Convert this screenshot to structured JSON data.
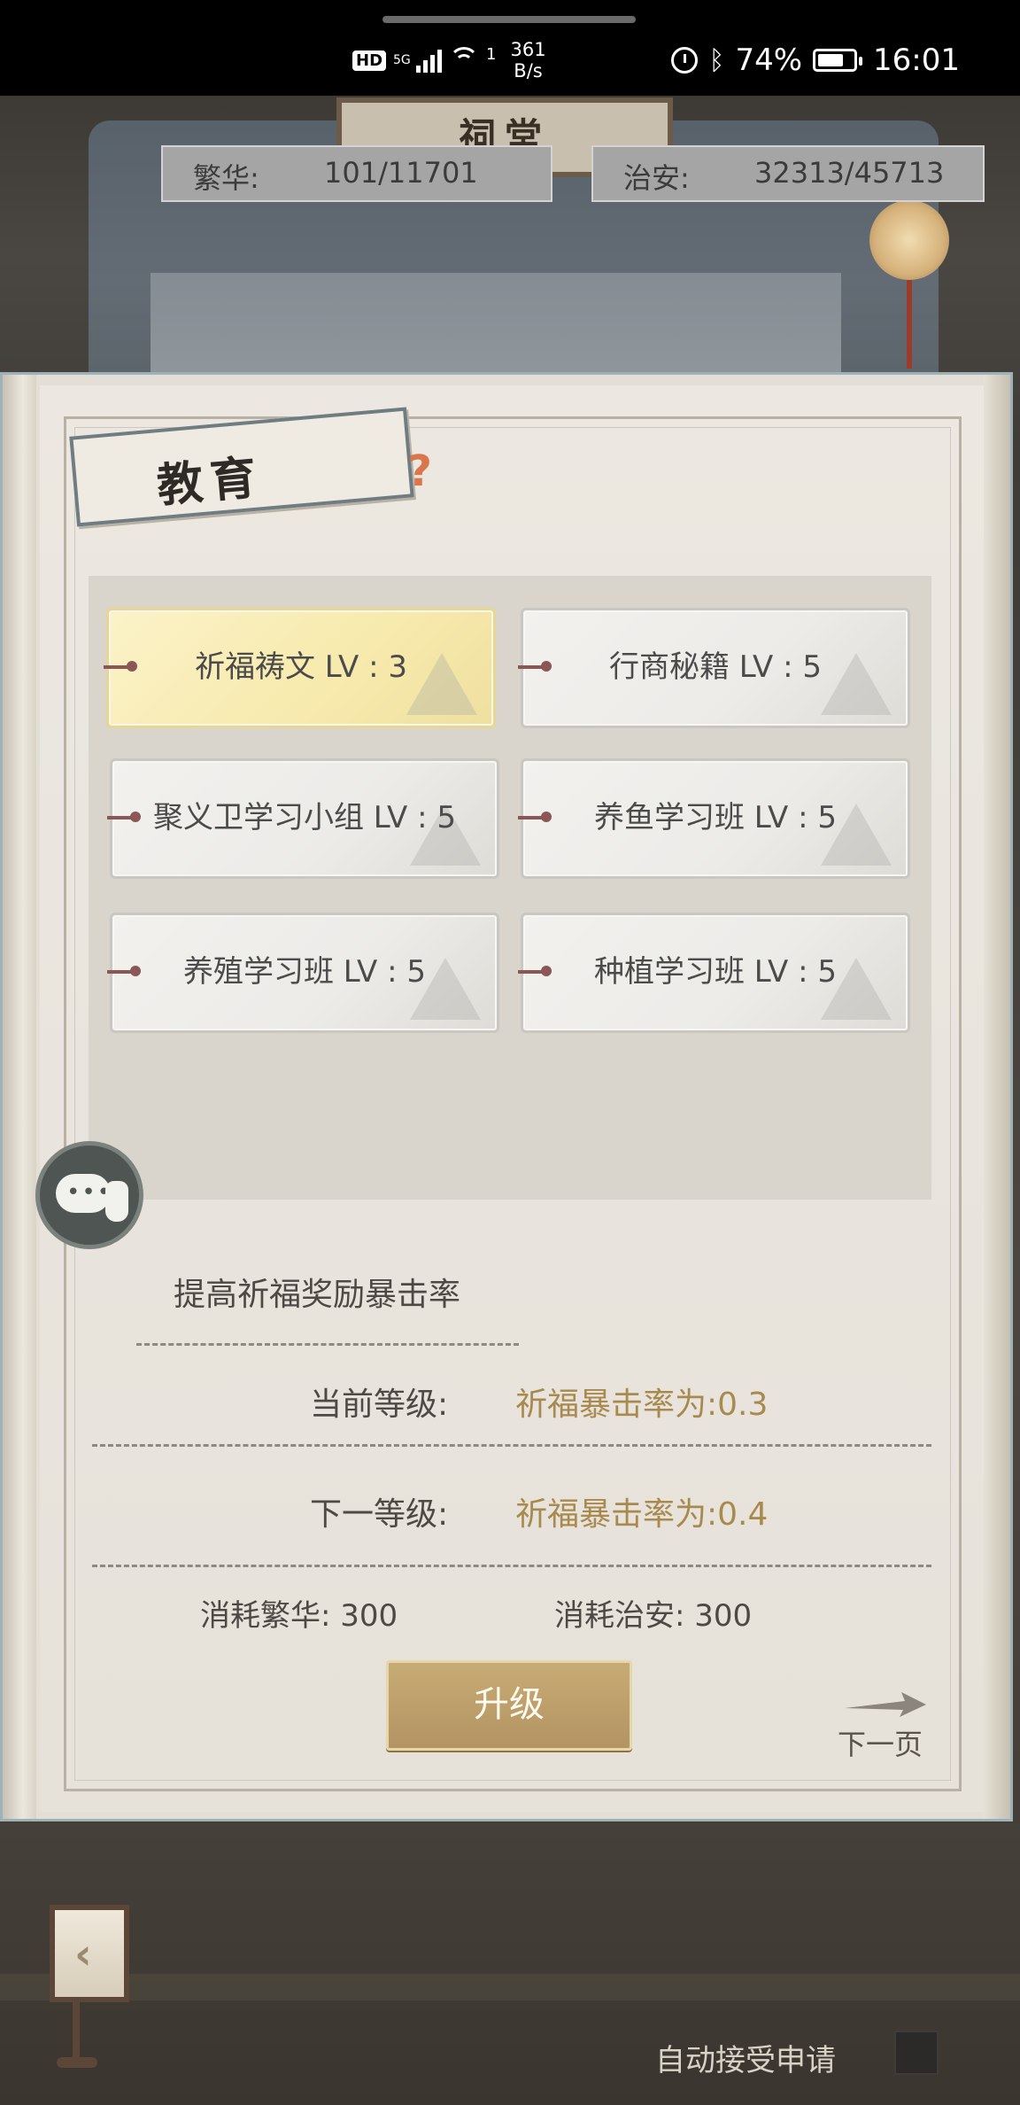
{
  "status_bar": {
    "hd": "HD",
    "network": "5G",
    "data_indicator": "1",
    "speed_value": "361",
    "speed_unit": "B/s",
    "battery": "74%",
    "battery_level": 0.74,
    "time": "16:01"
  },
  "scene": {
    "building_sign": "祠堂"
  },
  "resources": {
    "prosperity_label": "繁华:",
    "prosperity_value": "101/11701",
    "security_label": "治安:",
    "security_value": "32313/45713"
  },
  "panel": {
    "title": "教育",
    "help_icon": "question-icon",
    "skills": [
      {
        "label": "祈福祷文 LV : 3",
        "active": true
      },
      {
        "label": "行商秘籍 LV : 5",
        "active": false
      },
      {
        "label": "聚义卫学习小组 LV : 5",
        "active": false
      },
      {
        "label": "养鱼学习班 LV : 5",
        "active": false
      },
      {
        "label": "养殖学习班 LV : 5",
        "active": false
      },
      {
        "label": "种植学习班 LV : 5",
        "active": false
      }
    ],
    "description": "提高祈福奖励暴击率",
    "current_level_label": "当前等级:",
    "current_level_value": "祈福暴击率为:0.3",
    "next_level_label": "下一等级:",
    "next_level_value": "祈福暴击率为:0.4",
    "cost_prosperity": "消耗繁华: 300",
    "cost_security": "消耗治安: 300",
    "upgrade_button": "升级",
    "next_page": "下一页"
  },
  "bottom": {
    "auto_accept_label": "自动接受申请"
  },
  "colors": {
    "accent_gold": "#a88a4f",
    "button_gold": "#b39463",
    "active_skill": "#f7eaac"
  }
}
